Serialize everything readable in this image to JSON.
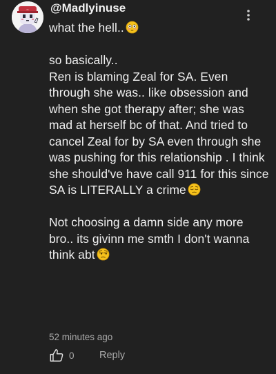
{
  "comment": {
    "username": "@Madlyinuse",
    "paragraphs": [
      {
        "text": "what the hell..",
        "emoji": "flushed-face-emoji"
      },
      {
        "text": "so basically..\nRen is blaming Zeal for SA. Even through she was.. like obsession and when she got therapy after; she was mad at herself bc of that. And tried to cancel Zeal for by SA even through she was pushing for this relationship . I think she should've have call 911 for this since SA is LITERALLY a crime",
        "emoji": "pensive-face-emoji"
      },
      {
        "text": "Not choosing a damn side any more bro.. its givinn me smth I don't wanna think abt",
        "emoji": "unamused-face-emoji"
      }
    ],
    "timestamp": "52 minutes ago",
    "like_count": "0",
    "reply_label": "Reply"
  },
  "colors": {
    "background": "#212121",
    "text_primary": "#f1f1f1",
    "text_secondary": "#aaaaaa",
    "emoji_yellow": "#f6c21c"
  }
}
